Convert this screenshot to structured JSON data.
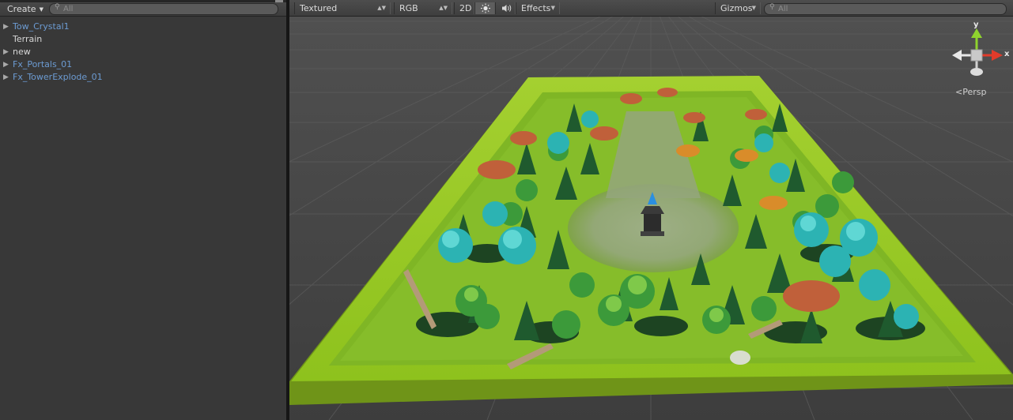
{
  "hierarchy": {
    "create_label": "Create",
    "search_placeholder": "All",
    "items": [
      {
        "name": "Tow_Crystal1",
        "expandable": true,
        "style": "prefab"
      },
      {
        "name": "Terrain",
        "expandable": false,
        "style": "plain"
      },
      {
        "name": "new",
        "expandable": true,
        "style": "plain"
      },
      {
        "name": "Fx_Portals_01",
        "expandable": true,
        "style": "prefab"
      },
      {
        "name": "Fx_TowerExplode_01",
        "expandable": true,
        "style": "prefab"
      }
    ]
  },
  "scene": {
    "shading_mode": "Textured",
    "render_mode": "RGB",
    "toggle_2d": "2D",
    "lighting_icon": "sun-icon",
    "audio_icon": "speaker-icon",
    "effects_label": "Effects",
    "gizmos_label": "Gizmos",
    "search_placeholder": "All",
    "gizmo": {
      "y_label": "y",
      "x_label": "x",
      "projection": "Persp"
    }
  },
  "colors": {
    "prefab_text": "#6c9bd2",
    "panel_bg": "#383838",
    "scene_bg": "#454545",
    "terrain_green": "#9ccc2a",
    "axis_x": "#e23b2a",
    "axis_y": "#8fd32e"
  }
}
